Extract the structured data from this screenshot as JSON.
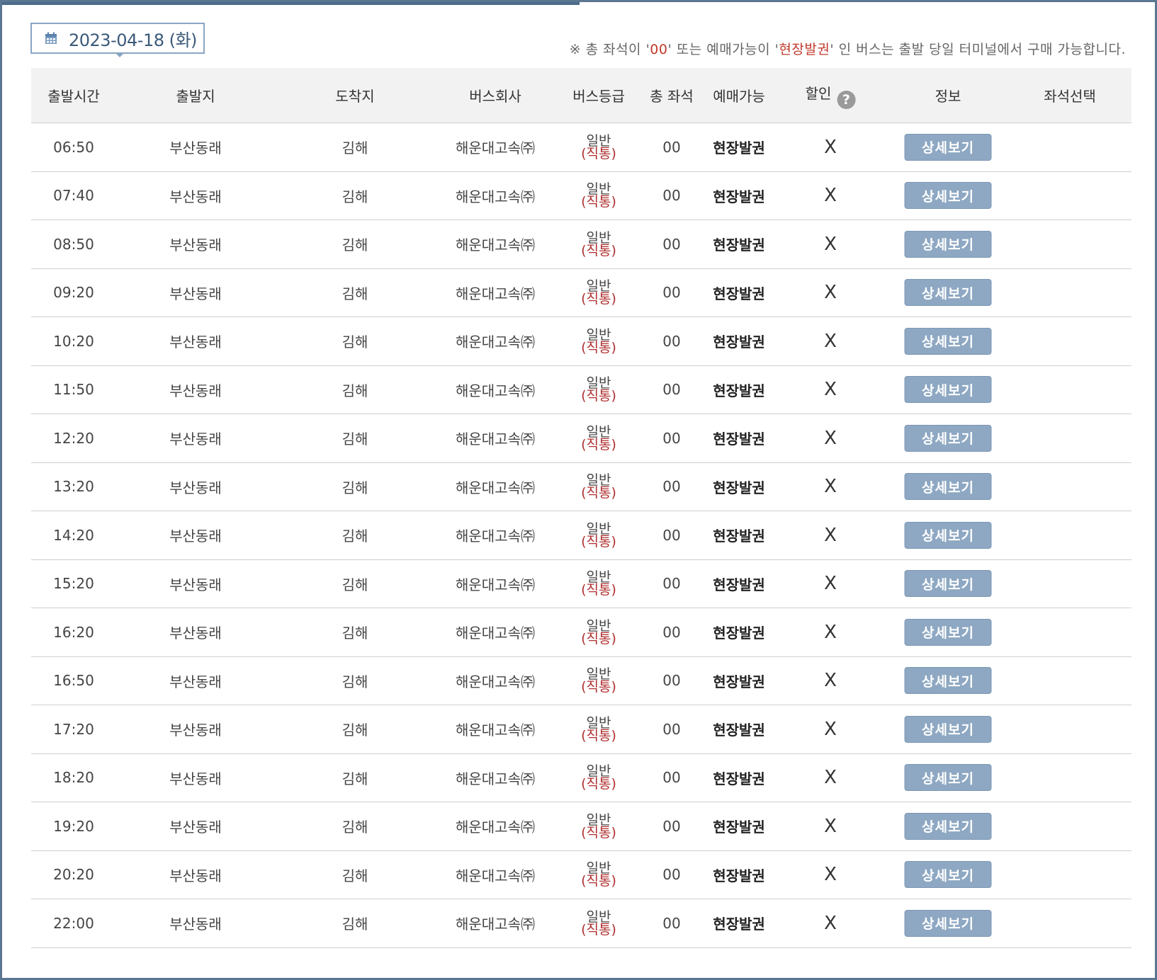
{
  "date_selector": {
    "label": "2023-04-18 (화)",
    "icon": "calendar-icon"
  },
  "notice": {
    "prefix": "※ 총 좌석이 '",
    "seat_value": "00",
    "middle": "' 또는 예매가능이 '",
    "on_site": "현장발권",
    "suffix": "' 인 버스는 출발 당일 터미널에서 구매 가능합니다."
  },
  "headers": {
    "departure_time": "출발시간",
    "origin": "출발지",
    "destination": "도착지",
    "bus_company": "버스회사",
    "bus_grade": "버스등급",
    "total_seats": "총 좌석",
    "booking": "예매가능",
    "discount": "할인",
    "discount_help_icon": "?",
    "info": "정보",
    "seat_select": "좌석선택"
  },
  "colors": {
    "accent": "#8ea8c3",
    "frame": "#5b7690",
    "red": "#c0392b"
  },
  "rows": [
    {
      "time": "06:50",
      "origin": "부산동래",
      "dest": "김해",
      "company": "해운대고속㈜",
      "grade1": "일반",
      "grade2": "(직통)",
      "seats": "00",
      "booking": "현장발권",
      "discount": "X",
      "button": "상세보기"
    },
    {
      "time": "07:40",
      "origin": "부산동래",
      "dest": "김해",
      "company": "해운대고속㈜",
      "grade1": "일반",
      "grade2": "(직통)",
      "seats": "00",
      "booking": "현장발권",
      "discount": "X",
      "button": "상세보기"
    },
    {
      "time": "08:50",
      "origin": "부산동래",
      "dest": "김해",
      "company": "해운대고속㈜",
      "grade1": "일반",
      "grade2": "(직통)",
      "seats": "00",
      "booking": "현장발권",
      "discount": "X",
      "button": "상세보기"
    },
    {
      "time": "09:20",
      "origin": "부산동래",
      "dest": "김해",
      "company": "해운대고속㈜",
      "grade1": "일반",
      "grade2": "(직통)",
      "seats": "00",
      "booking": "현장발권",
      "discount": "X",
      "button": "상세보기"
    },
    {
      "time": "10:20",
      "origin": "부산동래",
      "dest": "김해",
      "company": "해운대고속㈜",
      "grade1": "일반",
      "grade2": "(직통)",
      "seats": "00",
      "booking": "현장발권",
      "discount": "X",
      "button": "상세보기"
    },
    {
      "time": "11:50",
      "origin": "부산동래",
      "dest": "김해",
      "company": "해운대고속㈜",
      "grade1": "일반",
      "grade2": "(직통)",
      "seats": "00",
      "booking": "현장발권",
      "discount": "X",
      "button": "상세보기"
    },
    {
      "time": "12:20",
      "origin": "부산동래",
      "dest": "김해",
      "company": "해운대고속㈜",
      "grade1": "일반",
      "grade2": "(직통)",
      "seats": "00",
      "booking": "현장발권",
      "discount": "X",
      "button": "상세보기"
    },
    {
      "time": "13:20",
      "origin": "부산동래",
      "dest": "김해",
      "company": "해운대고속㈜",
      "grade1": "일반",
      "grade2": "(직통)",
      "seats": "00",
      "booking": "현장발권",
      "discount": "X",
      "button": "상세보기"
    },
    {
      "time": "14:20",
      "origin": "부산동래",
      "dest": "김해",
      "company": "해운대고속㈜",
      "grade1": "일반",
      "grade2": "(직통)",
      "seats": "00",
      "booking": "현장발권",
      "discount": "X",
      "button": "상세보기"
    },
    {
      "time": "15:20",
      "origin": "부산동래",
      "dest": "김해",
      "company": "해운대고속㈜",
      "grade1": "일반",
      "grade2": "(직통)",
      "seats": "00",
      "booking": "현장발권",
      "discount": "X",
      "button": "상세보기"
    },
    {
      "time": "16:20",
      "origin": "부산동래",
      "dest": "김해",
      "company": "해운대고속㈜",
      "grade1": "일반",
      "grade2": "(직통)",
      "seats": "00",
      "booking": "현장발권",
      "discount": "X",
      "button": "상세보기"
    },
    {
      "time": "16:50",
      "origin": "부산동래",
      "dest": "김해",
      "company": "해운대고속㈜",
      "grade1": "일반",
      "grade2": "(직통)",
      "seats": "00",
      "booking": "현장발권",
      "discount": "X",
      "button": "상세보기"
    },
    {
      "time": "17:20",
      "origin": "부산동래",
      "dest": "김해",
      "company": "해운대고속㈜",
      "grade1": "일반",
      "grade2": "(직통)",
      "seats": "00",
      "booking": "현장발권",
      "discount": "X",
      "button": "상세보기"
    },
    {
      "time": "18:20",
      "origin": "부산동래",
      "dest": "김해",
      "company": "해운대고속㈜",
      "grade1": "일반",
      "grade2": "(직통)",
      "seats": "00",
      "booking": "현장발권",
      "discount": "X",
      "button": "상세보기"
    },
    {
      "time": "19:20",
      "origin": "부산동래",
      "dest": "김해",
      "company": "해운대고속㈜",
      "grade1": "일반",
      "grade2": "(직통)",
      "seats": "00",
      "booking": "현장발권",
      "discount": "X",
      "button": "상세보기"
    },
    {
      "time": "20:20",
      "origin": "부산동래",
      "dest": "김해",
      "company": "해운대고속㈜",
      "grade1": "일반",
      "grade2": "(직통)",
      "seats": "00",
      "booking": "현장발권",
      "discount": "X",
      "button": "상세보기"
    },
    {
      "time": "22:00",
      "origin": "부산동래",
      "dest": "김해",
      "company": "해운대고속㈜",
      "grade1": "일반",
      "grade2": "(직통)",
      "seats": "00",
      "booking": "현장발권",
      "discount": "X",
      "button": "상세보기"
    }
  ]
}
